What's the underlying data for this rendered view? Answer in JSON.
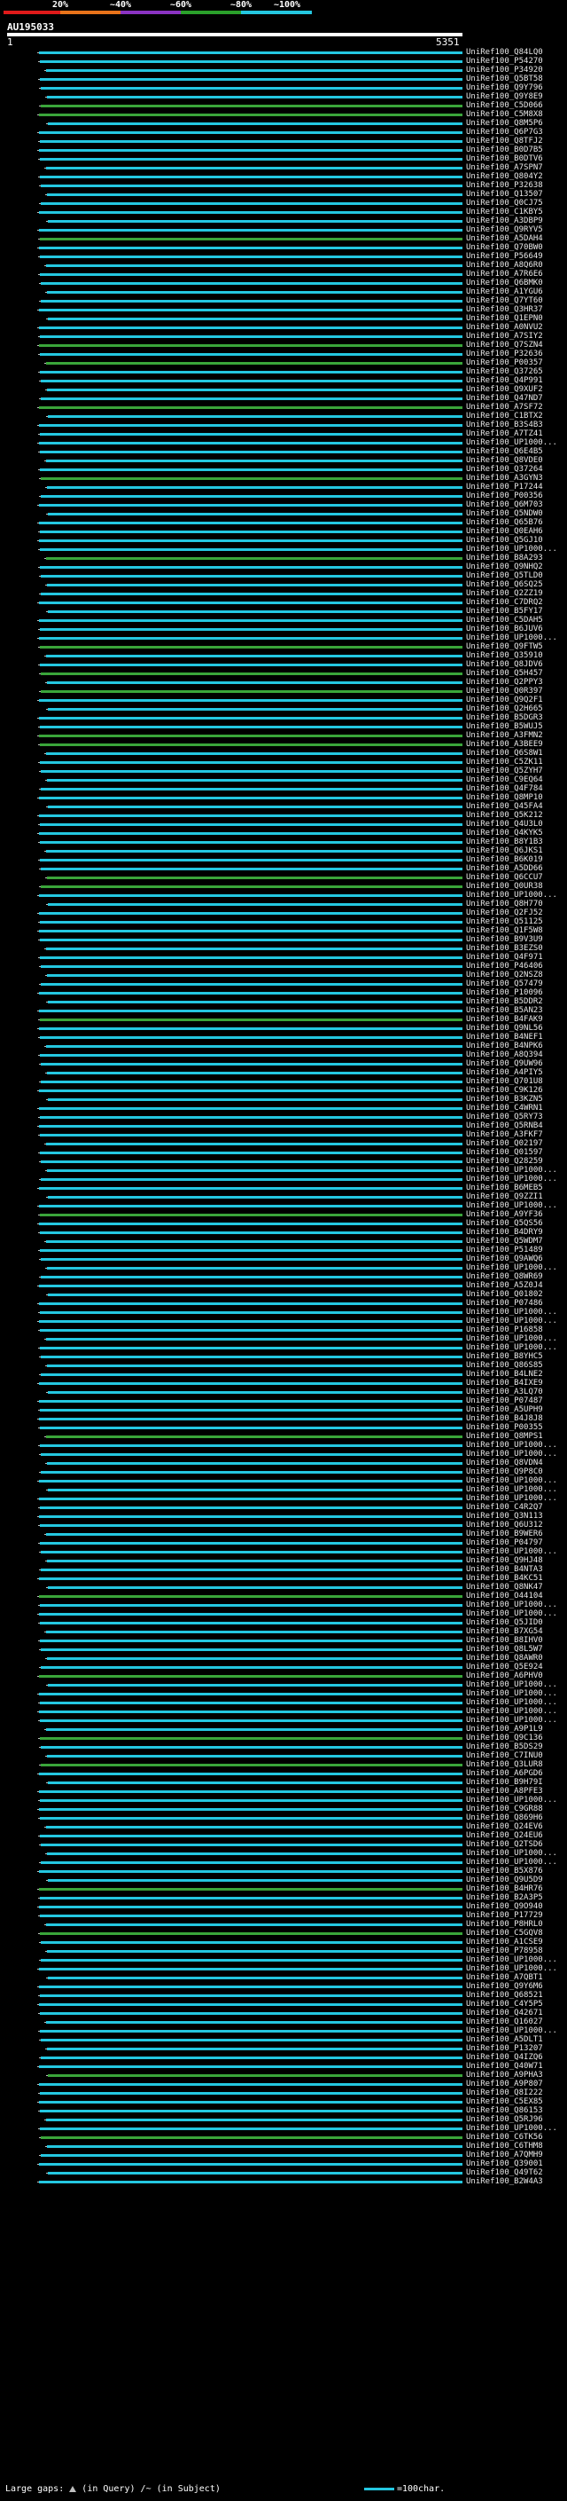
{
  "scale": {
    "labels": [
      "20%",
      "~40%",
      "~60%",
      "~80%",
      "~100%"
    ],
    "colors": [
      "#e01a1a",
      "#e8731a",
      "#8b33c2",
      "#2aa02a",
      "#24c7e0"
    ]
  },
  "query": {
    "id": "AU195033",
    "start": "1",
    "end": "5351"
  },
  "colors": {
    "cyan": "#24c7e0",
    "green": "#3aa53a",
    "gap": "#bfbfbf"
  },
  "hits": [
    {
      "label": "UniRef100_Q84LQ0",
      "color": "cyan"
    },
    {
      "label": "UniRef100_P54270",
      "color": "cyan"
    },
    {
      "label": "UniRef100_P34920",
      "color": "cyan"
    },
    {
      "label": "UniRef100_Q5BT58",
      "color": "cyan"
    },
    {
      "label": "UniRef100_Q9Y796",
      "color": "cyan"
    },
    {
      "label": "UniRef100_Q9Y8E9",
      "color": "cyan"
    },
    {
      "label": "UniRef100_C5D066",
      "color": "green"
    },
    {
      "label": "UniRef100_C5M8X8",
      "color": "green"
    },
    {
      "label": "UniRef100_Q8M5P6",
      "color": "cyan"
    },
    {
      "label": "UniRef100_Q6P7G3",
      "color": "cyan"
    },
    {
      "label": "UniRef100_Q8TFJ2",
      "color": "cyan"
    },
    {
      "label": "UniRef100_B0D7B5",
      "color": "cyan"
    },
    {
      "label": "UniRef100_B0DTV6",
      "color": "cyan"
    },
    {
      "label": "UniRef100_A7SPN7",
      "color": "cyan"
    },
    {
      "label": "UniRef100_Q804Y2",
      "color": "cyan"
    },
    {
      "label": "UniRef100_P32638",
      "color": "cyan"
    },
    {
      "label": "UniRef100_Q13507",
      "color": "cyan"
    },
    {
      "label": "UniRef100_Q0CJ75",
      "color": "cyan"
    },
    {
      "label": "UniRef100_C1KBY5",
      "color": "cyan"
    },
    {
      "label": "UniRef100_A3DBP9",
      "color": "cyan"
    },
    {
      "label": "UniRef100_Q9RYV5",
      "color": "cyan"
    },
    {
      "label": "UniRef100_A5DAH4",
      "color": "green"
    },
    {
      "label": "UniRef100_Q70BW0",
      "color": "cyan"
    },
    {
      "label": "UniRef100_P56649",
      "color": "cyan"
    },
    {
      "label": "UniRef100_A8Q6R0",
      "color": "cyan"
    },
    {
      "label": "UniRef100_A7R6E6",
      "color": "cyan"
    },
    {
      "label": "UniRef100_Q6BMK0",
      "color": "cyan"
    },
    {
      "label": "UniRef100_A1YGU6",
      "color": "cyan"
    },
    {
      "label": "UniRef100_Q7YT60",
      "color": "cyan"
    },
    {
      "label": "UniRef100_Q3HR37",
      "color": "cyan"
    },
    {
      "label": "UniRef100_Q1EPN0",
      "color": "cyan"
    },
    {
      "label": "UniRef100_A0NVU2",
      "color": "cyan"
    },
    {
      "label": "UniRef100_A7SIY2",
      "color": "cyan"
    },
    {
      "label": "UniRef100_Q7SZN4",
      "color": "green"
    },
    {
      "label": "UniRef100_P32636",
      "color": "cyan"
    },
    {
      "label": "UniRef100_P00357",
      "color": "green"
    },
    {
      "label": "UniRef100_Q37265",
      "color": "cyan"
    },
    {
      "label": "UniRef100_Q4P991",
      "color": "cyan"
    },
    {
      "label": "UniRef100_Q9XUF2",
      "color": "cyan"
    },
    {
      "label": "UniRef100_Q47ND7",
      "color": "cyan"
    },
    {
      "label": "UniRef100_A7SF72",
      "color": "green"
    },
    {
      "label": "UniRef100_C1BTX2",
      "color": "cyan"
    },
    {
      "label": "UniRef100_B3S4B3",
      "color": "cyan"
    },
    {
      "label": "UniRef100_A7TZ41",
      "color": "cyan"
    },
    {
      "label": "UniRef100_UP1000...",
      "color": "cyan"
    },
    {
      "label": "UniRef100_Q6E4B5",
      "color": "cyan"
    },
    {
      "label": "UniRef100_Q8VDE0",
      "color": "cyan"
    },
    {
      "label": "UniRef100_Q37264",
      "color": "cyan"
    },
    {
      "label": "UniRef100_A3GYN3",
      "color": "green"
    },
    {
      "label": "UniRef100_P17244",
      "color": "cyan"
    },
    {
      "label": "UniRef100_P00356",
      "color": "cyan"
    },
    {
      "label": "UniRef100_Q6M703",
      "color": "cyan"
    },
    {
      "label": "UniRef100_Q5NDW0",
      "color": "cyan"
    },
    {
      "label": "UniRef100_Q65B76",
      "color": "cyan"
    },
    {
      "label": "UniRef100_Q0EAH6",
      "color": "cyan"
    },
    {
      "label": "UniRef100_Q5GJ10",
      "color": "cyan"
    },
    {
      "label": "UniRef100_UP1000...",
      "color": "cyan"
    },
    {
      "label": "UniRef100_B8A293",
      "color": "green"
    },
    {
      "label": "UniRef100_Q9NHQ2",
      "color": "cyan"
    },
    {
      "label": "UniRef100_Q5TLD0",
      "color": "cyan"
    },
    {
      "label": "UniRef100_Q6SQ25",
      "color": "cyan"
    },
    {
      "label": "UniRef100_Q2ZZ19",
      "color": "cyan"
    },
    {
      "label": "UniRef100_C7DRQ2",
      "color": "cyan"
    },
    {
      "label": "UniRef100_B5FY17",
      "color": "cyan"
    },
    {
      "label": "UniRef100_C5DAH5",
      "color": "cyan"
    },
    {
      "label": "UniRef100_B6JUV6",
      "color": "cyan"
    },
    {
      "label": "UniRef100_UP1000...",
      "color": "cyan"
    },
    {
      "label": "UniRef100_Q9FTW5",
      "color": "green"
    },
    {
      "label": "UniRef100_Q35910",
      "color": "cyan"
    },
    {
      "label": "UniRef100_Q8JDV6",
      "color": "cyan"
    },
    {
      "label": "UniRef100_Q5H457",
      "color": "green"
    },
    {
      "label": "UniRef100_Q2PPY3",
      "color": "cyan"
    },
    {
      "label": "UniRef100_Q0R397",
      "color": "green"
    },
    {
      "label": "UniRef100_Q9Q2F1",
      "color": "cyan"
    },
    {
      "label": "UniRef100_Q2H665",
      "color": "cyan"
    },
    {
      "label": "UniRef100_B5DGR3",
      "color": "cyan"
    },
    {
      "label": "UniRef100_B5WUJ5",
      "color": "cyan"
    },
    {
      "label": "UniRef100_A3FMN2",
      "color": "green"
    },
    {
      "label": "UniRef100_A3BEE9",
      "color": "green"
    },
    {
      "label": "UniRef100_Q6S8W1",
      "color": "cyan"
    },
    {
      "label": "UniRef100_C5ZK11",
      "color": "cyan"
    },
    {
      "label": "UniRef100_Q5ZYH7",
      "color": "cyan"
    },
    {
      "label": "UniRef100_C9EQ64",
      "color": "cyan"
    },
    {
      "label": "UniRef100_Q4F784",
      "color": "cyan"
    },
    {
      "label": "UniRef100_Q8MP10",
      "color": "cyan"
    },
    {
      "label": "UniRef100_Q45FA4",
      "color": "cyan"
    },
    {
      "label": "UniRef100_Q5K212",
      "color": "cyan"
    },
    {
      "label": "UniRef100_Q4U3L0",
      "color": "cyan"
    },
    {
      "label": "UniRef100_Q4KYK5",
      "color": "cyan"
    },
    {
      "label": "UniRef100_B8Y1B3",
      "color": "cyan"
    },
    {
      "label": "UniRef100_Q6JKS1",
      "color": "cyan"
    },
    {
      "label": "UniRef100_B6K019",
      "color": "cyan"
    },
    {
      "label": "UniRef100_A5DD66",
      "color": "cyan"
    },
    {
      "label": "UniRef100_Q6CCU7",
      "color": "green"
    },
    {
      "label": "UniRef100_Q0UR38",
      "color": "green"
    },
    {
      "label": "UniRef100_UP1000...",
      "color": "cyan"
    },
    {
      "label": "UniRef100_Q8H770",
      "color": "cyan"
    },
    {
      "label": "UniRef100_Q2FJ52",
      "color": "cyan"
    },
    {
      "label": "UniRef100_Q51125",
      "color": "cyan"
    },
    {
      "label": "UniRef100_Q1F5W8",
      "color": "cyan"
    },
    {
      "label": "UniRef100_B9V3U9",
      "color": "cyan"
    },
    {
      "label": "UniRef100_B3EZS0",
      "color": "cyan"
    },
    {
      "label": "UniRef100_Q4F971",
      "color": "cyan"
    },
    {
      "label": "UniRef100_P46406",
      "color": "cyan"
    },
    {
      "label": "UniRef100_Q2NSZ8",
      "color": "cyan"
    },
    {
      "label": "UniRef100_Q57479",
      "color": "cyan"
    },
    {
      "label": "UniRef100_P10096",
      "color": "cyan"
    },
    {
      "label": "UniRef100_B5DDR2",
      "color": "cyan"
    },
    {
      "label": "UniRef100_B5AN23",
      "color": "cyan"
    },
    {
      "label": "UniRef100_B4FAK9",
      "color": "green"
    },
    {
      "label": "UniRef100_Q9NL56",
      "color": "cyan"
    },
    {
      "label": "UniRef100_B4NEF1",
      "color": "cyan"
    },
    {
      "label": "UniRef100_B4NPK6",
      "color": "cyan"
    },
    {
      "label": "UniRef100_A8Q394",
      "color": "cyan"
    },
    {
      "label": "UniRef100_Q9UW96",
      "color": "cyan"
    },
    {
      "label": "UniRef100_A4PIY5",
      "color": "cyan"
    },
    {
      "label": "UniRef100_Q701U8",
      "color": "cyan"
    },
    {
      "label": "UniRef100_C9K126",
      "color": "cyan"
    },
    {
      "label": "UniRef100_B3KZN5",
      "color": "cyan"
    },
    {
      "label": "UniRef100_C4WRN1",
      "color": "cyan"
    },
    {
      "label": "UniRef100_Q5RY73",
      "color": "cyan"
    },
    {
      "label": "UniRef100_Q5RNB4",
      "color": "cyan"
    },
    {
      "label": "UniRef100_A3FKF7",
      "color": "cyan"
    },
    {
      "label": "UniRef100_Q02197",
      "color": "cyan"
    },
    {
      "label": "UniRef100_Q01597",
      "color": "cyan"
    },
    {
      "label": "UniRef100_Q28259",
      "color": "cyan"
    },
    {
      "label": "UniRef100_UP1000...",
      "color": "cyan"
    },
    {
      "label": "UniRef100_UP1000...",
      "color": "cyan"
    },
    {
      "label": "UniRef100_B6MEB5",
      "color": "cyan"
    },
    {
      "label": "UniRef100_Q9ZZI1",
      "color": "cyan"
    },
    {
      "label": "UniRef100_UP1000...",
      "color": "cyan"
    },
    {
      "label": "UniRef100_A9YF36",
      "color": "green"
    },
    {
      "label": "UniRef100_Q5QS56",
      "color": "cyan"
    },
    {
      "label": "UniRef100_B4DRY9",
      "color": "cyan"
    },
    {
      "label": "UniRef100_Q5WDM7",
      "color": "cyan"
    },
    {
      "label": "UniRef100_P51489",
      "color": "cyan"
    },
    {
      "label": "UniRef100_Q9AWQ6",
      "color": "cyan"
    },
    {
      "label": "UniRef100_UP1000...",
      "color": "cyan"
    },
    {
      "label": "UniRef100_Q8WR69",
      "color": "cyan"
    },
    {
      "label": "UniRef100_A5Z0J4",
      "color": "cyan"
    },
    {
      "label": "UniRef100_Q01802",
      "color": "cyan"
    },
    {
      "label": "UniRef100_P07486",
      "color": "cyan"
    },
    {
      "label": "UniRef100_UP1000...",
      "color": "cyan"
    },
    {
      "label": "UniRef100_UP1000...",
      "color": "cyan"
    },
    {
      "label": "UniRef100_P16858",
      "color": "cyan"
    },
    {
      "label": "UniRef100_UP1000...",
      "color": "cyan"
    },
    {
      "label": "UniRef100_UP1000...",
      "color": "cyan"
    },
    {
      "label": "UniRef100_B8YHC5",
      "color": "cyan"
    },
    {
      "label": "UniRef100_Q86S85",
      "color": "cyan"
    },
    {
      "label": "UniRef100_B4LNE2",
      "color": "cyan"
    },
    {
      "label": "UniRef100_B4IXE9",
      "color": "cyan"
    },
    {
      "label": "UniRef100_A3LQ70",
      "color": "cyan"
    },
    {
      "label": "UniRef100_P07487",
      "color": "cyan"
    },
    {
      "label": "UniRef100_A5UPH9",
      "color": "cyan"
    },
    {
      "label": "UniRef100_B4J8J8",
      "color": "cyan"
    },
    {
      "label": "UniRef100_P00355",
      "color": "cyan"
    },
    {
      "label": "UniRef100_Q8MPS1",
      "color": "green"
    },
    {
      "label": "UniRef100_UP1000...",
      "color": "cyan"
    },
    {
      "label": "UniRef100_UP1000...",
      "color": "cyan"
    },
    {
      "label": "UniRef100_Q8VDN4",
      "color": "cyan"
    },
    {
      "label": "UniRef100_Q9P8C0",
      "color": "cyan"
    },
    {
      "label": "UniRef100_UP1000...",
      "color": "cyan"
    },
    {
      "label": "UniRef100_UP1000...",
      "color": "cyan"
    },
    {
      "label": "UniRef100_UP1000...",
      "color": "cyan"
    },
    {
      "label": "UniRef100_C4R2Q7",
      "color": "cyan"
    },
    {
      "label": "UniRef100_Q3N113",
      "color": "cyan"
    },
    {
      "label": "UniRef100_Q6U312",
      "color": "cyan"
    },
    {
      "label": "UniRef100_B9WER6",
      "color": "cyan"
    },
    {
      "label": "UniRef100_P04797",
      "color": "cyan"
    },
    {
      "label": "UniRef100_UP1000...",
      "color": "cyan"
    },
    {
      "label": "UniRef100_Q9HJ48",
      "color": "cyan"
    },
    {
      "label": "UniRef100_B4NTA3",
      "color": "cyan"
    },
    {
      "label": "UniRef100_B4KC51",
      "color": "cyan"
    },
    {
      "label": "UniRef100_Q8NK47",
      "color": "cyan"
    },
    {
      "label": "UniRef100_O44104",
      "color": "green"
    },
    {
      "label": "UniRef100_UP1000...",
      "color": "cyan"
    },
    {
      "label": "UniRef100_UP1000...",
      "color": "cyan"
    },
    {
      "label": "UniRef100_Q5JID0",
      "color": "cyan"
    },
    {
      "label": "UniRef100_B7XG54",
      "color": "cyan"
    },
    {
      "label": "UniRef100_B8IHV0",
      "color": "cyan"
    },
    {
      "label": "UniRef100_Q8L5W7",
      "color": "cyan"
    },
    {
      "label": "UniRef100_Q8AWR0",
      "color": "cyan"
    },
    {
      "label": "UniRef100_Q5E924",
      "color": "cyan"
    },
    {
      "label": "UniRef100_A6PHV0",
      "color": "green"
    },
    {
      "label": "UniRef100_UP1000...",
      "color": "cyan"
    },
    {
      "label": "UniRef100_UP1000...",
      "color": "cyan"
    },
    {
      "label": "UniRef100_UP1000...",
      "color": "cyan"
    },
    {
      "label": "UniRef100_UP1000...",
      "color": "cyan"
    },
    {
      "label": "UniRef100_UP1000...",
      "color": "cyan"
    },
    {
      "label": "UniRef100_A9P1L9",
      "color": "cyan"
    },
    {
      "label": "UniRef100_Q9C136",
      "color": "green"
    },
    {
      "label": "UniRef100_B5DS29",
      "color": "cyan"
    },
    {
      "label": "UniRef100_C7INU0",
      "color": "cyan"
    },
    {
      "label": "UniRef100_Q3LUR8",
      "color": "green"
    },
    {
      "label": "UniRef100_A6PGD6",
      "color": "cyan"
    },
    {
      "label": "UniRef100_B9H79I",
      "color": "cyan"
    },
    {
      "label": "UniRef100_A8PFE3",
      "color": "cyan"
    },
    {
      "label": "UniRef100_UP1000...",
      "color": "cyan"
    },
    {
      "label": "UniRef100_C9GR88",
      "color": "cyan"
    },
    {
      "label": "UniRef100_Q869H6",
      "color": "cyan"
    },
    {
      "label": "UniRef100_Q24EV6",
      "color": "cyan"
    },
    {
      "label": "UniRef100_Q24EU6",
      "color": "cyan"
    },
    {
      "label": "UniRef100_Q2TSD6",
      "color": "cyan"
    },
    {
      "label": "UniRef100_UP1000...",
      "color": "cyan"
    },
    {
      "label": "UniRef100_UP1000...",
      "color": "cyan"
    },
    {
      "label": "UniRef100_B5X876",
      "color": "cyan"
    },
    {
      "label": "UniRef100_Q9U5D9",
      "color": "cyan"
    },
    {
      "label": "UniRef100_B4HR76",
      "color": "green"
    },
    {
      "label": "UniRef100_B2A3P5",
      "color": "cyan"
    },
    {
      "label": "UniRef100_Q9O940",
      "color": "cyan"
    },
    {
      "label": "UniRef100_P17729",
      "color": "cyan"
    },
    {
      "label": "UniRef100_P8HRL0",
      "color": "cyan"
    },
    {
      "label": "UniRef100_C5GQV8",
      "color": "green"
    },
    {
      "label": "UniRef100_A1CSE9",
      "color": "cyan"
    },
    {
      "label": "UniRef100_P78958",
      "color": "cyan"
    },
    {
      "label": "UniRef100_UP1000...",
      "color": "cyan"
    },
    {
      "label": "UniRef100_UP1000...",
      "color": "cyan"
    },
    {
      "label": "UniRef100_A7QBT1",
      "color": "cyan"
    },
    {
      "label": "UniRef100_Q9Y6M6",
      "color": "cyan"
    },
    {
      "label": "UniRef100_Q68521",
      "color": "cyan"
    },
    {
      "label": "UniRef100_C4Y5P5",
      "color": "cyan"
    },
    {
      "label": "UniRef100_Q42671",
      "color": "cyan"
    },
    {
      "label": "UniRef100_Q16027",
      "color": "cyan"
    },
    {
      "label": "UniRef100_UP1000...",
      "color": "cyan"
    },
    {
      "label": "UniRef100_A5DLT1",
      "color": "cyan"
    },
    {
      "label": "UniRef100_P13207",
      "color": "cyan"
    },
    {
      "label": "UniRef100_Q4IZQ6",
      "color": "cyan"
    },
    {
      "label": "UniRef100_Q40W71",
      "color": "cyan"
    },
    {
      "label": "UniRef100_A9PHA3",
      "color": "green"
    },
    {
      "label": "UniRef100_A9P807",
      "color": "cyan"
    },
    {
      "label": "UniRef100_Q8I222",
      "color": "cyan"
    },
    {
      "label": "UniRef100_C5EX85",
      "color": "cyan"
    },
    {
      "label": "UniRef100_Q86153",
      "color": "cyan"
    },
    {
      "label": "UniRef100_Q5RJ96",
      "color": "cyan"
    },
    {
      "label": "UniRef100_UP1000...",
      "color": "cyan"
    },
    {
      "label": "UniRef100_C6TK56",
      "color": "green"
    },
    {
      "label": "UniRef100_C6THM8",
      "color": "cyan"
    },
    {
      "label": "UniRef100_A7QMH9",
      "color": "cyan"
    },
    {
      "label": "UniRef100_Q39001",
      "color": "cyan"
    },
    {
      "label": "UniRef100_Q49T62",
      "color": "cyan"
    },
    {
      "label": "UniRef100_B2W4A3",
      "color": "cyan"
    }
  ],
  "footer": {
    "prefix": "Large gaps:",
    "in_query": "(in Query)",
    "separator": "/~",
    "in_subject": "(in Subject)",
    "legend": "=100char."
  }
}
